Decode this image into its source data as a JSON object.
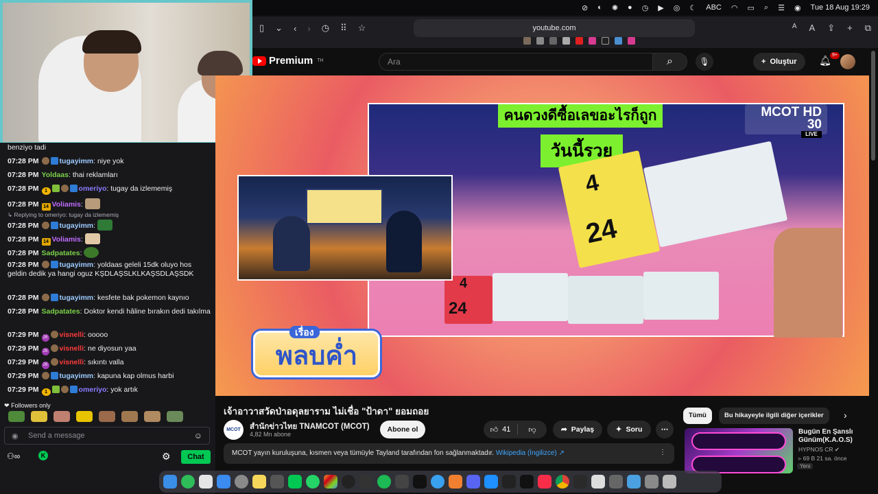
{
  "menubar": {
    "input_label": "ABC",
    "clock": "Tue 18 Aug  19:29"
  },
  "browser": {
    "address": "youtube.com"
  },
  "youtube": {
    "logo_text": "Premium",
    "logo_sup": "TH",
    "search_placeholder": "Ara",
    "create_label": "Oluştur",
    "notif_count": "9+"
  },
  "video": {
    "banner_top": "คนดวงดีซื้อเลขอะไรก็ถูก",
    "banner_day": "วันนี้รวย",
    "channel_bug": "MCOT HD 30",
    "live_label": "LIVE",
    "program_title": "พลบค่ำ",
    "program_sub": "เรื่อง",
    "ticket_big1": "4",
    "ticket_big2": "24",
    "ticket_small1": "4",
    "ticket_small2": "24"
  },
  "below": {
    "title": "เจ้าอาวาสวัดป่าอดุลยาราม ไม่เชื่อ \"ป้าดา\" ยอมถอย",
    "channel_logo": "MCOT",
    "channel_name": "สำนักข่าวไทย TNAMCOT (MCOT)",
    "subscribers": "4,82 Mn abone",
    "subscribe": "Abone ol",
    "likes": "41",
    "share": "Paylaş",
    "ask": "Soru",
    "notice": "MCOT yayın kuruluşuna, kısmen veya tümüyle Tayland tarafından fon sağlanmaktadır. ",
    "notice_link": "Wikipedia (İngilizce) ↗"
  },
  "right": {
    "chip_all": "Tümü",
    "chip_related": "Bu hikayeyle ilgili diğer içerikler",
    "rec_title_1": "Bugün En Şanslı",
    "rec_title_2": "Günüm(K.A.O.S)",
    "rec_channel": "HYPNOS CR",
    "rec_meta": "69 B    21 sa. önce",
    "rec_new": "Yeni"
  },
  "chat": {
    "top_partial": "benziyo tadi",
    "messages": [
      {
        "time": "07:28 PM",
        "user": "tugayimm",
        "color": "#9ecbff",
        "text": "niye yok"
      },
      {
        "time": "07:28 PM",
        "user": "Yoldaas",
        "color": "#7bd148",
        "text": "thai reklamları"
      },
      {
        "time": "07:28 PM",
        "user": "omeriyo",
        "color": "#8a7cff",
        "text": "tugay da izlememiş"
      },
      {
        "time": "07:28 PM",
        "user": "Voliamis",
        "color": "#c06cff",
        "text": ""
      },
      {
        "time": "07:28 PM",
        "user": "tugayimm",
        "color": "#9ecbff",
        "text": ""
      },
      {
        "time": "07:28 PM",
        "user": "Voliamis",
        "color": "#c06cff",
        "text": ""
      },
      {
        "time": "07:28 PM",
        "user": "Sadpatates",
        "color": "#7bd148",
        "text": ""
      },
      {
        "time": "07:28 PM",
        "user": "tugayimm",
        "color": "#9ecbff",
        "text": "yoldaas geleli 15dk oluyo hos geldin dedik ya hangi oguz KŞDLAŞSLKLKAŞSDLAŞSDK"
      },
      {
        "time": "07:28 PM",
        "user": "tugayimm",
        "color": "#9ecbff",
        "text": "kesfete bak pokemon kaynıo"
      },
      {
        "time": "07:28 PM",
        "user": "Sadpatates",
        "color": "#7bd148",
        "text": "Doktor kendi hâline bırakın dedi takılma"
      },
      {
        "time": "07:29 PM",
        "user": "visnelli",
        "color": "#ff3b3b",
        "text": "ooooo"
      },
      {
        "time": "07:29 PM",
        "user": "visnelli",
        "color": "#ff3b3b",
        "text": "ne diyosun yaa"
      },
      {
        "time": "07:29 PM",
        "user": "visnelli",
        "color": "#ff3b3b",
        "text": "sıkıntı valla"
      },
      {
        "time": "07:29 PM",
        "user": "tugayimm",
        "color": "#9ecbff",
        "text": "kapuna kap olmus harbi"
      },
      {
        "time": "07:29 PM",
        "user": "omeriyo",
        "color": "#8a7cff",
        "text": "yok artık"
      }
    ],
    "reply_note": "↳ Replying to omeriyo: tugay da izlememiş",
    "badge_14": "14",
    "badge_26": "26",
    "badge_1": "1",
    "followers_only": "Followers only",
    "send_placeholder": "Send a message",
    "chat_button": "Chat"
  }
}
